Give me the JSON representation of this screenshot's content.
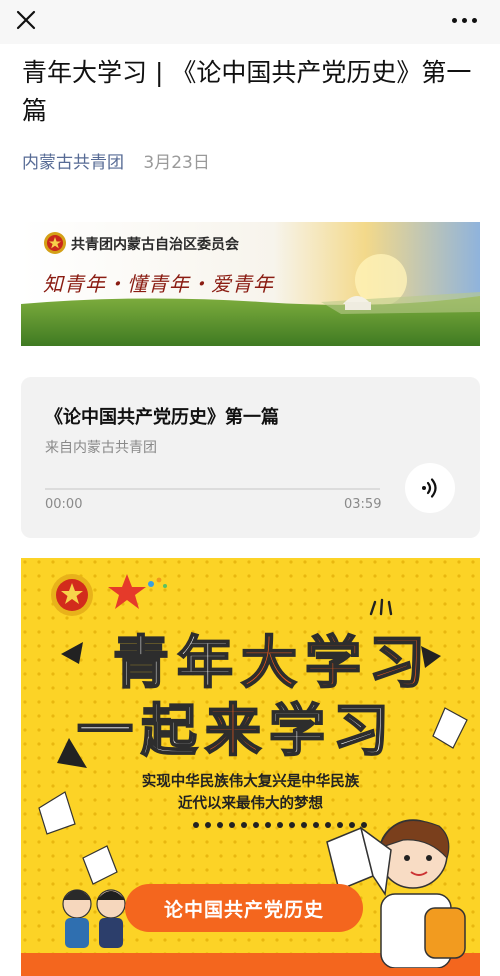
{
  "nav": {
    "close_icon": "close-icon",
    "more_icon": "more-dots-icon"
  },
  "article": {
    "title": "青年大学习 | 《论中国共产党历史》第一篇",
    "account": "内蒙古共青团",
    "date": "3月23日"
  },
  "banner": {
    "org": "共青团内蒙古自治区委员会",
    "slogan": "知青年・懂青年・爱青年"
  },
  "audio": {
    "title": "《论中国共产党历史》第一篇",
    "source": "来自内蒙古共青团",
    "current_time": "00:00",
    "duration": "03:59",
    "progress": 0
  },
  "poster": {
    "line1_a": "青年",
    "line1_b": "大学习",
    "line2_a": "一起",
    "line2_b": "来",
    "line2_c": "学习",
    "sub1": "实现中华民族伟大复兴是中华民族",
    "sub2": "近代以来最伟大的梦想",
    "button": "论中国共产党历史"
  },
  "colors": {
    "link": "#576b95",
    "poster_bg": "#fcd326",
    "accent": "#f05a1e"
  }
}
